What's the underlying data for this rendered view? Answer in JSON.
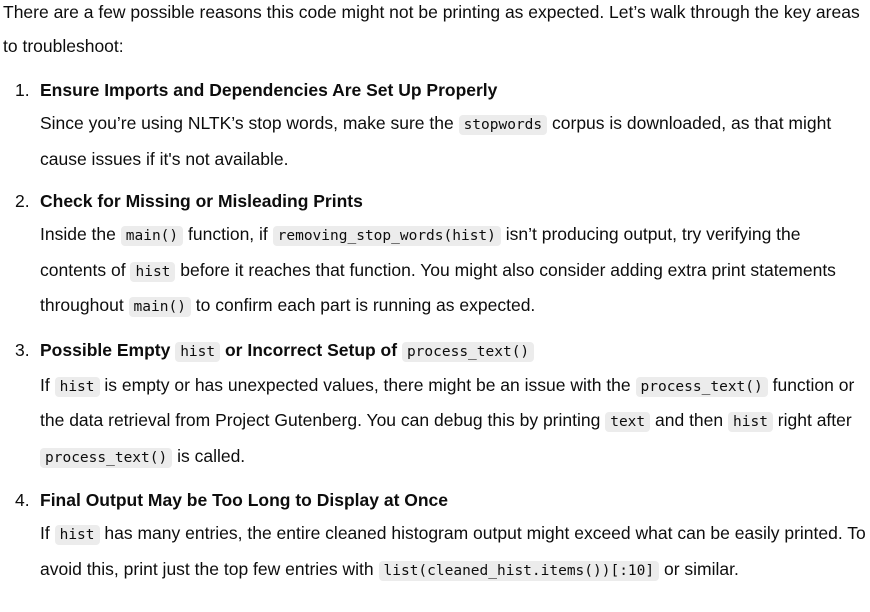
{
  "intro": [
    {
      "t": "text",
      "v": "There are a few possible reasons this code might not be printing as expected. Let’s walk through the key areas to troubleshoot:"
    }
  ],
  "items": [
    {
      "number": "1.",
      "heading": [
        {
          "t": "text",
          "v": "Ensure Imports and Dependencies Are Set Up Properly"
        }
      ],
      "body": [
        {
          "t": "text",
          "v": "Since you’re using NLTK’s stop words, make sure the "
        },
        {
          "t": "code",
          "v": "stopwords"
        },
        {
          "t": "text",
          "v": " corpus is downloaded, as that might cause issues if it's not available."
        }
      ]
    },
    {
      "number": "2.",
      "heading": [
        {
          "t": "text",
          "v": "Check for Missing or Misleading Prints"
        }
      ],
      "body": [
        {
          "t": "text",
          "v": "Inside the "
        },
        {
          "t": "code",
          "v": "main()"
        },
        {
          "t": "text",
          "v": " function, if "
        },
        {
          "t": "code",
          "v": "removing_stop_words(hist)"
        },
        {
          "t": "text",
          "v": " isn’t producing output, try verifying the contents of "
        },
        {
          "t": "code",
          "v": "hist"
        },
        {
          "t": "text",
          "v": " before it reaches that function. You might also consider adding extra print statements throughout "
        },
        {
          "t": "code",
          "v": "main()"
        },
        {
          "t": "text",
          "v": " to confirm each part is running as expected."
        }
      ]
    },
    {
      "number": "3.",
      "heading": [
        {
          "t": "text",
          "v": "Possible Empty "
        },
        {
          "t": "code",
          "v": "hist"
        },
        {
          "t": "text",
          "v": " or Incorrect Setup of "
        },
        {
          "t": "code",
          "v": "process_text()"
        }
      ],
      "body": [
        {
          "t": "text",
          "v": "If "
        },
        {
          "t": "code",
          "v": "hist"
        },
        {
          "t": "text",
          "v": " is empty or has unexpected values, there might be an issue with the "
        },
        {
          "t": "code",
          "v": "process_text()"
        },
        {
          "t": "text",
          "v": " function or the data retrieval from Project Gutenberg. You can debug this by printing "
        },
        {
          "t": "code",
          "v": "text"
        },
        {
          "t": "text",
          "v": " and then "
        },
        {
          "t": "code",
          "v": "hist"
        },
        {
          "t": "text",
          "v": " right after "
        },
        {
          "t": "code",
          "v": "process_text()"
        },
        {
          "t": "text",
          "v": " is called."
        }
      ]
    },
    {
      "number": "4.",
      "heading": [
        {
          "t": "text",
          "v": "Final Output May be Too Long to Display at Once"
        }
      ],
      "body": [
        {
          "t": "text",
          "v": "If "
        },
        {
          "t": "code",
          "v": "hist"
        },
        {
          "t": "text",
          "v": " has many entries, the entire cleaned histogram output might exceed what can be easily printed. To avoid this, print just the top few entries with "
        },
        {
          "t": "code",
          "v": "list(cleaned_hist.items())[:10]"
        },
        {
          "t": "text",
          "v": " or similar."
        }
      ]
    }
  ]
}
